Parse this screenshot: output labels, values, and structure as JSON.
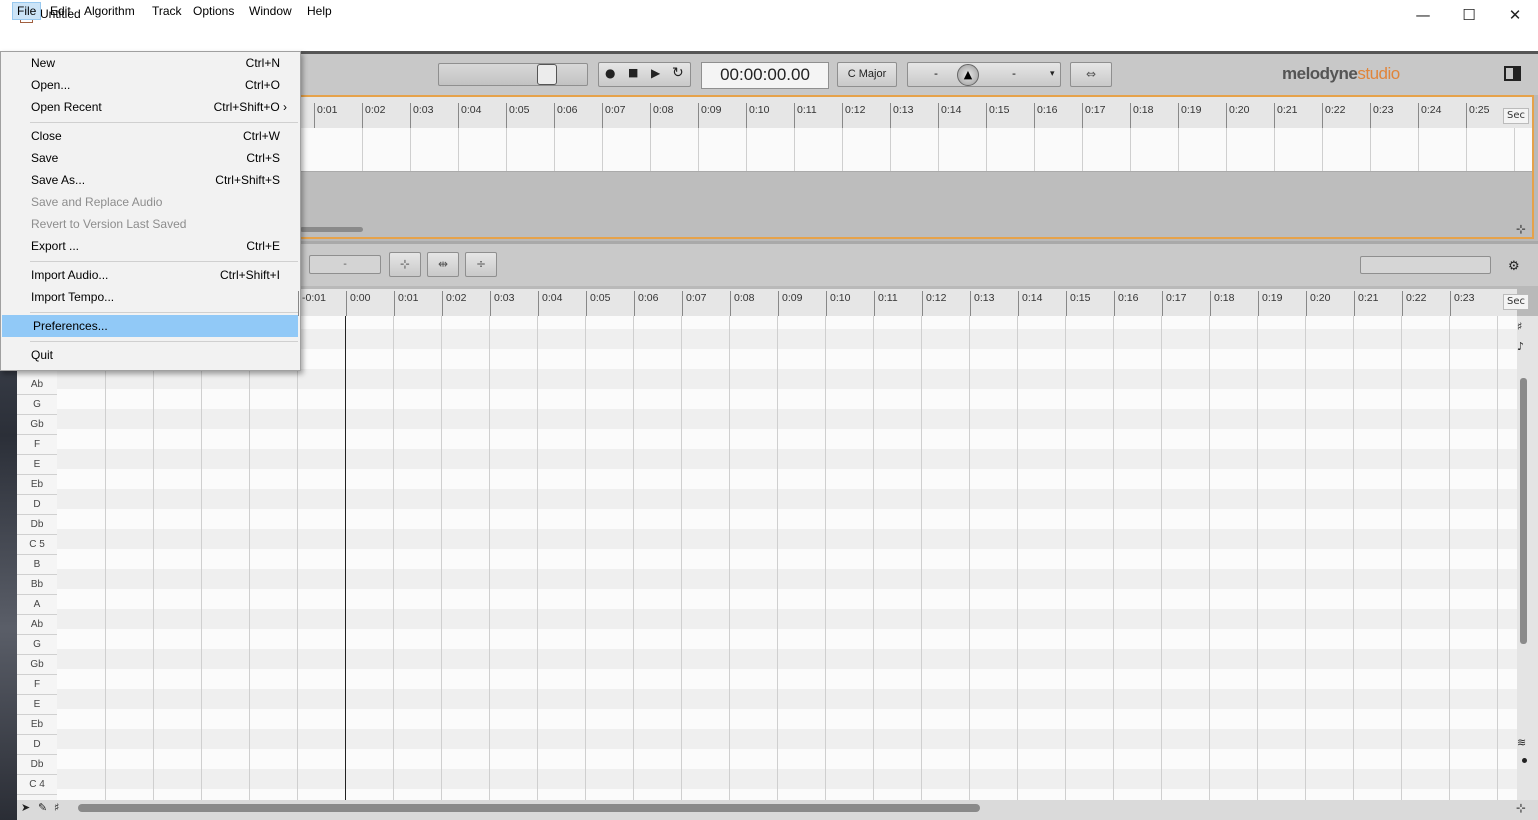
{
  "window": {
    "title": "Untitled",
    "minimize": "—",
    "maximize": "☐",
    "close": "✕"
  },
  "menubar": [
    "File",
    "Edit",
    "Algorithm",
    "Track",
    "Options",
    "Window",
    "Help"
  ],
  "transport": {
    "time": "00:00:00.00",
    "key": "C Major",
    "pitch_left": "-",
    "pitch_right": "-"
  },
  "logo": {
    "brand": "melodyne",
    "edition": "studio"
  },
  "editor_toolbar": {
    "field": "-"
  },
  "arrangement_ruler": {
    "labels": [
      "0:01",
      "0:02",
      "0:03",
      "0:04",
      "0:05",
      "0:06",
      "0:07",
      "0:08",
      "0:09",
      "0:10",
      "0:11",
      "0:12",
      "0:13",
      "0:14",
      "0:15",
      "0:16",
      "0:17",
      "0:18",
      "0:19",
      "0:20",
      "0:21",
      "0:22",
      "0:23",
      "0:24",
      "0:25"
    ],
    "unit": "Sec"
  },
  "editor_ruler": {
    "labels": [
      "-0:01",
      "0:00",
      "0:01",
      "0:02",
      "0:03",
      "0:04",
      "0:05",
      "0:06",
      "0:07",
      "0:08",
      "0:09",
      "0:10",
      "0:11",
      "0:12",
      "0:13",
      "0:14",
      "0:15",
      "0:16",
      "0:17",
      "0:18",
      "0:19",
      "0:20",
      "0:21",
      "0:22",
      "0:23"
    ],
    "unit": "Sec"
  },
  "pitch_keys": [
    "Ab",
    "G",
    "Gb",
    "F",
    "E",
    "Eb",
    "D",
    "Db",
    "C 5",
    "B",
    "Bb",
    "A",
    "Ab",
    "G",
    "Gb",
    "F",
    "E",
    "Eb",
    "D",
    "Db",
    "C 4"
  ],
  "file_menu": [
    {
      "label": "New",
      "shortcut": "Ctrl+N",
      "enabled": true
    },
    {
      "label": "Open...",
      "shortcut": "Ctrl+O",
      "enabled": true
    },
    {
      "label": "Open Recent",
      "shortcut": "Ctrl+Shift+O ›",
      "enabled": true
    },
    {
      "label": "Close",
      "shortcut": "Ctrl+W",
      "enabled": true
    },
    {
      "label": "Save",
      "shortcut": "Ctrl+S",
      "enabled": true
    },
    {
      "label": "Save As...",
      "shortcut": "Ctrl+Shift+S",
      "enabled": true
    },
    {
      "label": "Save and Replace Audio",
      "shortcut": "",
      "enabled": false
    },
    {
      "label": "Revert to Version Last Saved",
      "shortcut": "",
      "enabled": false
    },
    {
      "label": "Export ...",
      "shortcut": "Ctrl+E",
      "enabled": true
    },
    {
      "label": "Import Audio...",
      "shortcut": "Ctrl+Shift+I",
      "enabled": true
    },
    {
      "label": "Import Tempo...",
      "shortcut": "",
      "enabled": true
    },
    {
      "label": "Preferences...",
      "shortcut": "",
      "enabled": true,
      "highlighted": true
    },
    {
      "label": "Quit",
      "shortcut": "",
      "enabled": true
    }
  ],
  "colors": {
    "accent": "#e6a24a",
    "highlight": "#91c9f7",
    "menu_open": "#cce4f7"
  }
}
